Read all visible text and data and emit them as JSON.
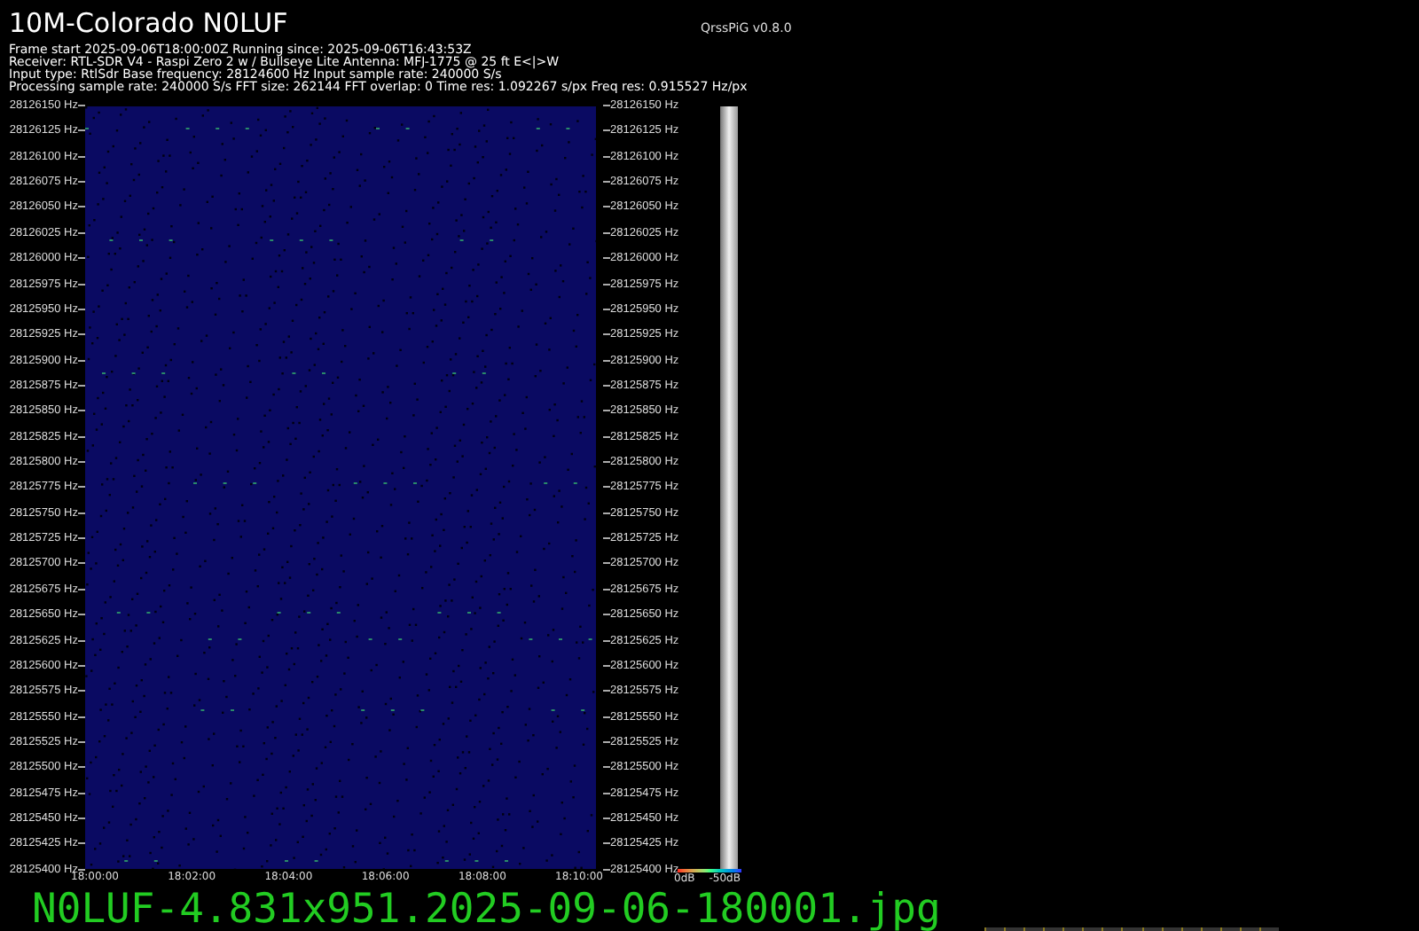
{
  "title": "10M-Colorado N0LUF",
  "version": "QrssPiG v0.8.0",
  "info_lines": [
    "Frame start 2025-09-06T18:00:00Z Running since: 2025-09-06T16:43:53Z",
    "Receiver: RTL-SDR V4 - Raspi Zero 2 w / Bullseye Lite Antenna: MFJ-1775 @ 25 ft E<|>W",
    "Input type: RtlSdr Base frequency: 28124600 Hz Input sample rate: 240000 S/s",
    "Processing sample rate: 240000 S/s FFT size: 262144 FFT overlap: 0 Time res: 1.092267 s/px Freq res: 0.915527 Hz/px"
  ],
  "waterfall": {
    "freq_labels_left": [
      "28126150 Hz",
      "28126125 Hz",
      "28126100 Hz",
      "28126075 Hz",
      "28126050 Hz",
      "28126025 Hz",
      "28126000 Hz",
      "28125975 Hz",
      "28125950 Hz",
      "28125925 Hz",
      "28125900 Hz",
      "28125875 Hz",
      "28125850 Hz",
      "28125825 Hz",
      "28125800 Hz",
      "28125775 Hz",
      "28125750 Hz",
      "28125725 Hz",
      "28125700 Hz",
      "28125675 Hz",
      "28125650 Hz",
      "28125625 Hz",
      "28125600 Hz",
      "28125575 Hz",
      "28125550 Hz",
      "28125525 Hz",
      "28125500 Hz",
      "28125475 Hz",
      "28125450 Hz",
      "28125425 Hz",
      "28125400 Hz"
    ],
    "freq_labels_right": [
      "28126150 Hz",
      "28126125 Hz",
      "28126100 Hz",
      "28126075 Hz",
      "28126050 Hz",
      "28126025 Hz",
      "28126000 Hz",
      "28125975 Hz",
      "28125950 Hz",
      "28125925 Hz",
      "28125900 Hz",
      "28125875 Hz",
      "28125850 Hz",
      "28125825 Hz",
      "28125800 Hz",
      "28125775 Hz",
      "28125750 Hz",
      "28125725 Hz",
      "28125700 Hz",
      "28125675 Hz",
      "28125650 Hz",
      "28125625 Hz",
      "28125600 Hz",
      "28125575 Hz",
      "28125550 Hz",
      "28125525 Hz",
      "28125500 Hz",
      "28125475 Hz",
      "28125450 Hz",
      "28125425 Hz",
      "28125400 Hz"
    ],
    "time_labels": [
      "18:00:00",
      "18:02:00",
      "18:04:00",
      "18:06:00",
      "18:08:00",
      "18:10:00"
    ]
  },
  "scale": {
    "max_label": "0dB",
    "min_label": "-50dB"
  },
  "filename": "N0LUF-4.831x951.2025-09-06-180001.jpg"
}
